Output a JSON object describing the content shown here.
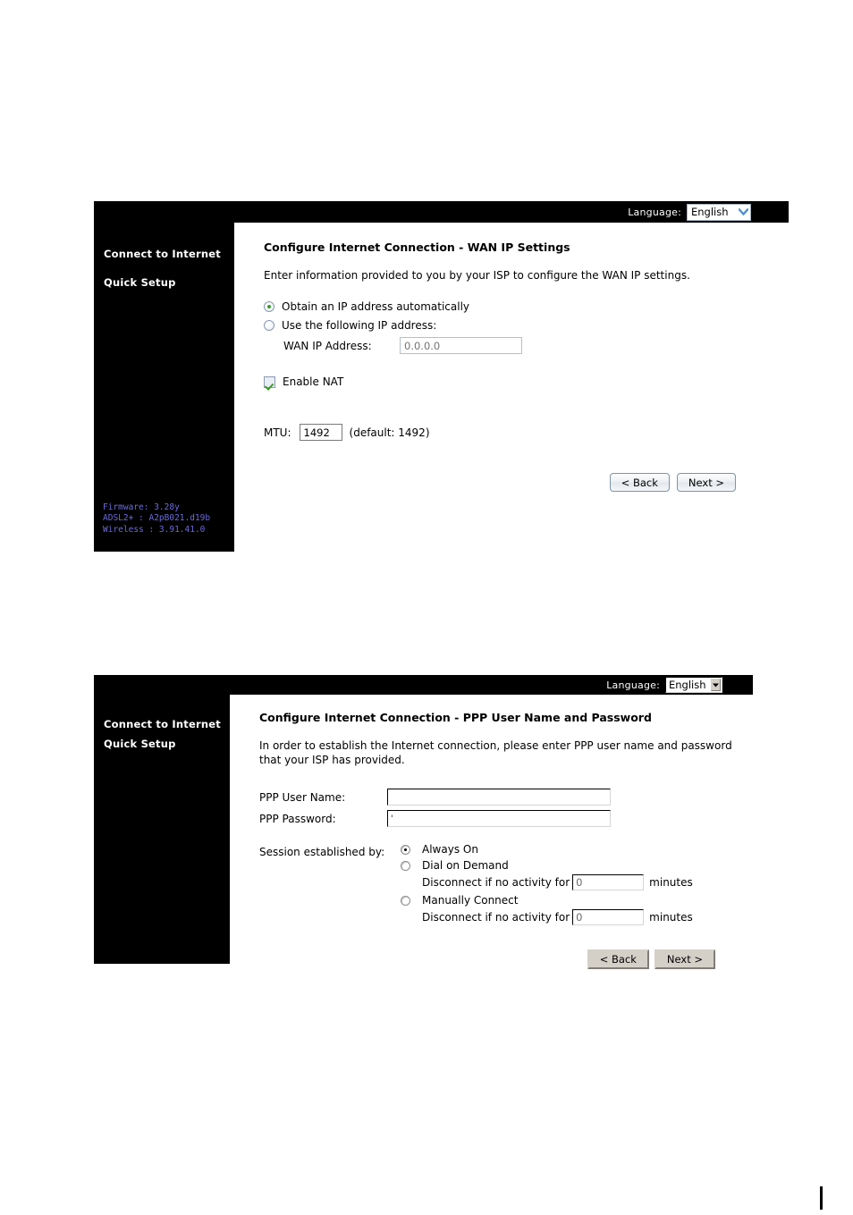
{
  "panel1": {
    "header": {
      "language_label": "Language:",
      "language_value": "English",
      "chevron_icon": "chevron-down-icon"
    },
    "sidebar": {
      "nav": [
        {
          "label": "Connect to Internet"
        },
        {
          "label": "Quick Setup"
        }
      ],
      "firmware": {
        "line1": "Firmware:  3.28y",
        "line2": "ADSL2+ :  A2pB021.d19b",
        "line3": "Wireless :  3.91.41.0"
      }
    },
    "content": {
      "title": "Configure Internet Connection - WAN IP Settings",
      "description": "Enter information provided to you by your ISP to configure the WAN IP settings.",
      "radio_auto": {
        "label": "Obtain an IP address automatically",
        "checked": true
      },
      "radio_manual": {
        "label": "Use the following IP address:",
        "checked": false
      },
      "wan_ip": {
        "label": "WAN IP Address:",
        "value": "",
        "placeholder": "0.0.0.0"
      },
      "enable_nat": {
        "label": "Enable NAT",
        "checked": true
      },
      "mtu": {
        "label": "MTU:",
        "value": "1492",
        "hint": "(default: 1492)"
      },
      "buttons": {
        "back": "< Back",
        "next": "Next >"
      }
    }
  },
  "panel2": {
    "header": {
      "language_label": "Language:",
      "language_value": "English",
      "chevron_icon": "chevron-down-icon"
    },
    "sidebar": {
      "nav": [
        {
          "label": "Connect to Internet"
        },
        {
          "label": "Quick Setup"
        }
      ]
    },
    "content": {
      "title": "Configure Internet Connection - PPP User Name and Password",
      "description": "In order to establish the Internet connection, please enter PPP user name and password that your ISP has provided.",
      "ppp_user": {
        "label": "PPP User Name:",
        "value": ""
      },
      "ppp_password": {
        "label": "PPP Password:",
        "value": "'"
      },
      "session_label": "Session established by:",
      "session_options": [
        {
          "label": "Always On",
          "checked": true
        },
        {
          "label": "Dial on Demand",
          "checked": false
        },
        {
          "label": "Manually Connect",
          "checked": false
        }
      ],
      "disconnect1": {
        "prefix": "Disconnect if no activity for",
        "value": "0",
        "suffix": "minutes"
      },
      "disconnect2": {
        "prefix": "Disconnect if no activity for",
        "value": "0",
        "suffix": "minutes"
      },
      "buttons": {
        "back": "< Back",
        "next": "Next >"
      }
    }
  },
  "colors": {
    "sidebar_bg": "#000000",
    "firmware_text": "#6b6bdc",
    "radio_dot": "#3c9a28",
    "check_mark": "#3c9a28",
    "chevron_blue": "#4d8fd1"
  }
}
